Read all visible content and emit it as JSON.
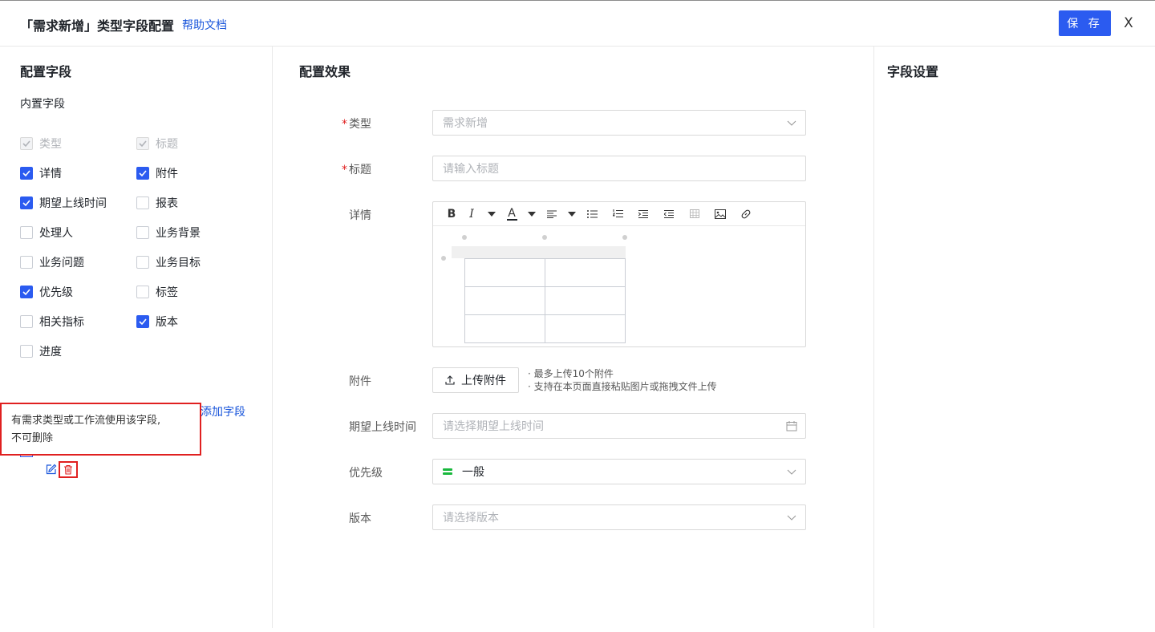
{
  "header": {
    "title": "「需求新增」类型字段配置",
    "help_link": "帮助文档",
    "save_label": "保 存",
    "close_label": "X"
  },
  "left_panel": {
    "title": "配置字段",
    "section_title": "内置字段",
    "fields": [
      {
        "label": "类型",
        "checked": true,
        "disabled": true
      },
      {
        "label": "标题",
        "checked": true,
        "disabled": true
      },
      {
        "label": "详情",
        "checked": true,
        "disabled": false
      },
      {
        "label": "附件",
        "checked": true,
        "disabled": false
      },
      {
        "label": "期望上线时间",
        "checked": true,
        "disabled": false
      },
      {
        "label": "报表",
        "checked": false,
        "disabled": false
      },
      {
        "label": "处理人",
        "checked": false,
        "disabled": false
      },
      {
        "label": "业务背景",
        "checked": false,
        "disabled": false
      },
      {
        "label": "业务问题",
        "checked": false,
        "disabled": false
      },
      {
        "label": "业务目标",
        "checked": false,
        "disabled": false
      },
      {
        "label": "优先级",
        "checked": true,
        "disabled": false
      },
      {
        "label": "标签",
        "checked": false,
        "disabled": false
      },
      {
        "label": "相关指标",
        "checked": false,
        "disabled": false
      },
      {
        "label": "版本",
        "checked": true,
        "disabled": false
      },
      {
        "label": "进度",
        "checked": false,
        "disabled": false
      }
    ],
    "add_field_label": "添加字段",
    "tooltip_line1": "有需求类型或工作流使用该字段,",
    "tooltip_line2": "不可删除"
  },
  "mid_panel": {
    "title": "配置效果",
    "type_label": "类型",
    "type_value": "需求新增",
    "title_label": "标题",
    "title_placeholder": "请输入标题",
    "detail_label": "详情",
    "toolbar": {
      "bold": "B",
      "italic": "I",
      "font_color": "A"
    },
    "attachment_label": "附件",
    "upload_label": "上传附件",
    "upload_hint1": "· 最多上传10个附件",
    "upload_hint2": "· 支持在本页面直接粘贴图片或拖拽文件上传",
    "launch_time_label": "期望上线时间",
    "launch_time_placeholder": "请选择期望上线时间",
    "priority_label": "优先级",
    "priority_value": "一般",
    "priority_color": "#18b83c",
    "version_label": "版本",
    "version_placeholder": "请选择版本",
    "required_mark": "*"
  },
  "right_panel": {
    "title": "字段设置"
  },
  "colors": {
    "primary": "#2b5bf0",
    "link": "#1a56db",
    "danger": "#e02020"
  }
}
